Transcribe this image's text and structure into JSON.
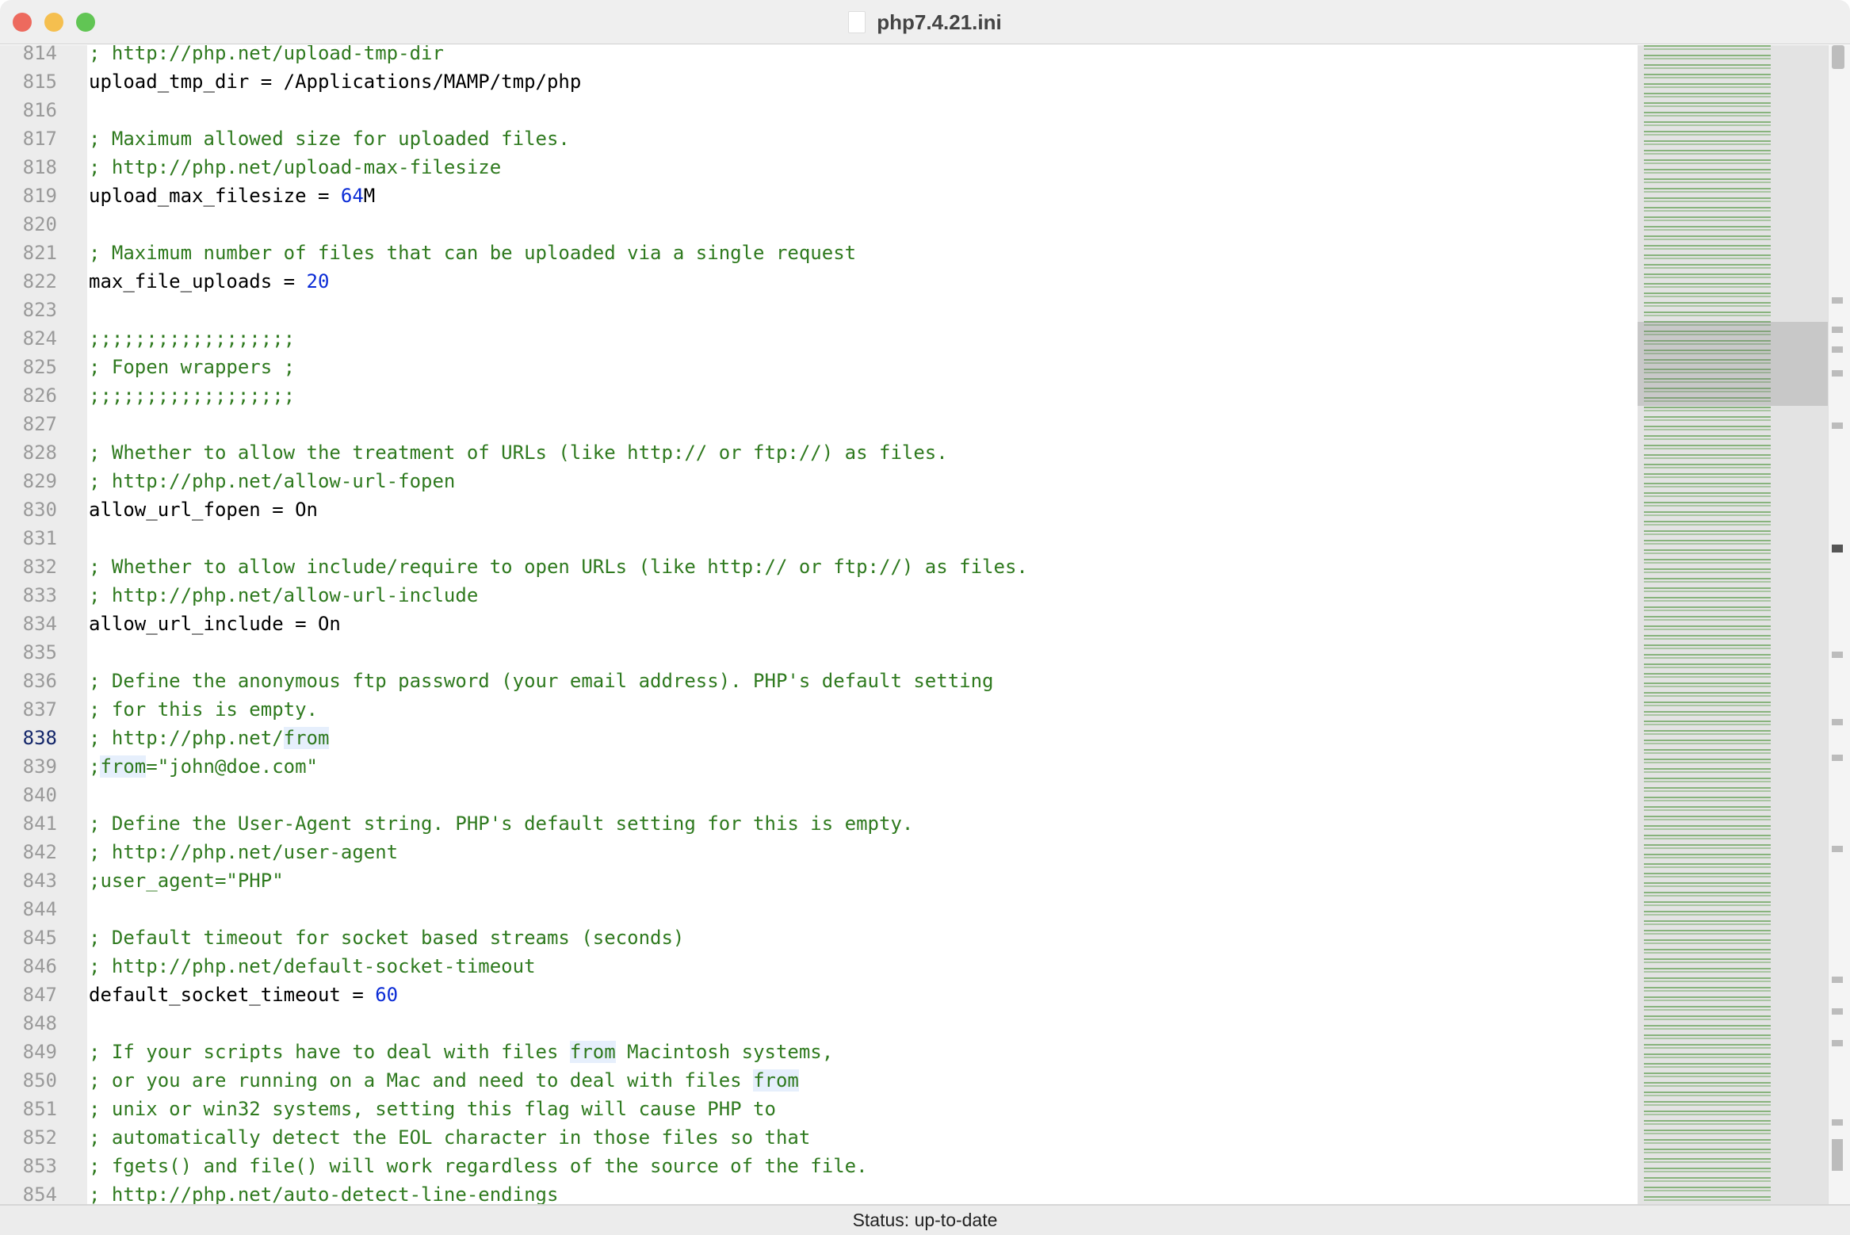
{
  "window": {
    "title": "php7.4.21.ini"
  },
  "status": {
    "text": "Status: up-to-date"
  },
  "colors": {
    "comment": "#2f7a1f",
    "number": "#0a2bd6",
    "highlight": "#e6effc",
    "current_line_number": "#14276a"
  },
  "editor": {
    "current_line": 838,
    "lines": [
      {
        "n": "814",
        "s": [
          [
            "c",
            "; http://php.net/upload-tmp-dir"
          ]
        ]
      },
      {
        "n": "815",
        "s": [
          [
            "k",
            "upload_tmp_dir = /Applications/MAMP/tmp/php"
          ]
        ]
      },
      {
        "n": "816",
        "s": []
      },
      {
        "n": "817",
        "s": [
          [
            "c",
            "; Maximum allowed size for uploaded files."
          ]
        ]
      },
      {
        "n": "818",
        "s": [
          [
            "c",
            "; http://php.net/upload-max-filesize"
          ]
        ]
      },
      {
        "n": "819",
        "s": [
          [
            "k",
            "upload_max_filesize = "
          ],
          [
            "n",
            "64"
          ],
          [
            "k",
            "M"
          ]
        ]
      },
      {
        "n": "820",
        "s": []
      },
      {
        "n": "821",
        "s": [
          [
            "c",
            "; Maximum number of files that can be uploaded via a single request"
          ]
        ]
      },
      {
        "n": "822",
        "s": [
          [
            "k",
            "max_file_uploads = "
          ],
          [
            "n",
            "20"
          ]
        ]
      },
      {
        "n": "823",
        "s": []
      },
      {
        "n": "824",
        "s": [
          [
            "c",
            ";;;;;;;;;;;;;;;;;;"
          ]
        ]
      },
      {
        "n": "825",
        "s": [
          [
            "c",
            "; Fopen wrappers ;"
          ]
        ]
      },
      {
        "n": "826",
        "s": [
          [
            "c",
            ";;;;;;;;;;;;;;;;;;"
          ]
        ]
      },
      {
        "n": "827",
        "s": []
      },
      {
        "n": "828",
        "s": [
          [
            "c",
            "; Whether to allow the treatment of URLs (like http:// or ftp://) as files."
          ]
        ]
      },
      {
        "n": "829",
        "s": [
          [
            "c",
            "; http://php.net/allow-url-fopen"
          ]
        ]
      },
      {
        "n": "830",
        "s": [
          [
            "k",
            "allow_url_fopen = On"
          ]
        ]
      },
      {
        "n": "831",
        "s": []
      },
      {
        "n": "832",
        "s": [
          [
            "c",
            "; Whether to allow include/require to open URLs (like http:// or ftp://) as files."
          ]
        ]
      },
      {
        "n": "833",
        "s": [
          [
            "c",
            "; http://php.net/allow-url-include"
          ]
        ]
      },
      {
        "n": "834",
        "s": [
          [
            "k",
            "allow_url_include = On"
          ]
        ]
      },
      {
        "n": "835",
        "s": []
      },
      {
        "n": "836",
        "s": [
          [
            "c",
            "; Define the anonymous ftp password (your email address). PHP's default setting"
          ]
        ]
      },
      {
        "n": "837",
        "s": [
          [
            "c",
            "; for this is empty."
          ]
        ]
      },
      {
        "n": "838",
        "s": [
          [
            "c",
            "; http://php.net/"
          ],
          [
            "h",
            "from"
          ]
        ]
      },
      {
        "n": "839",
        "s": [
          [
            "c",
            ";"
          ],
          [
            "h",
            "from"
          ],
          [
            "c",
            "=\"john@doe.com\""
          ]
        ]
      },
      {
        "n": "840",
        "s": []
      },
      {
        "n": "841",
        "s": [
          [
            "c",
            "; Define the User-Agent string. PHP's default setting for this is empty."
          ]
        ]
      },
      {
        "n": "842",
        "s": [
          [
            "c",
            "; http://php.net/user-agent"
          ]
        ]
      },
      {
        "n": "843",
        "s": [
          [
            "c",
            ";user_agent=\"PHP\""
          ]
        ]
      },
      {
        "n": "844",
        "s": []
      },
      {
        "n": "845",
        "s": [
          [
            "c",
            "; Default timeout for socket based streams (seconds)"
          ]
        ]
      },
      {
        "n": "846",
        "s": [
          [
            "c",
            "; http://php.net/default-socket-timeout"
          ]
        ]
      },
      {
        "n": "847",
        "s": [
          [
            "k",
            "default_socket_timeout = "
          ],
          [
            "n",
            "60"
          ]
        ]
      },
      {
        "n": "848",
        "s": []
      },
      {
        "n": "849",
        "s": [
          [
            "c",
            "; If your scripts have to deal with files "
          ],
          [
            "h",
            "from"
          ],
          [
            "c",
            " Macintosh systems,"
          ]
        ]
      },
      {
        "n": "850",
        "s": [
          [
            "c",
            "; or you are running on a Mac and need to deal with files "
          ],
          [
            "h",
            "from"
          ]
        ]
      },
      {
        "n": "851",
        "s": [
          [
            "c",
            "; unix or win32 systems, setting this flag will cause PHP to"
          ]
        ]
      },
      {
        "n": "852",
        "s": [
          [
            "c",
            "; automatically detect the EOL character in those files so that"
          ]
        ]
      },
      {
        "n": "853",
        "s": [
          [
            "c",
            "; fgets() and file() will work regardless of the source of the file."
          ]
        ]
      },
      {
        "n": "854",
        "s": [
          [
            "c",
            "; http://php.net/auto-detect-line-endings"
          ]
        ]
      }
    ]
  }
}
